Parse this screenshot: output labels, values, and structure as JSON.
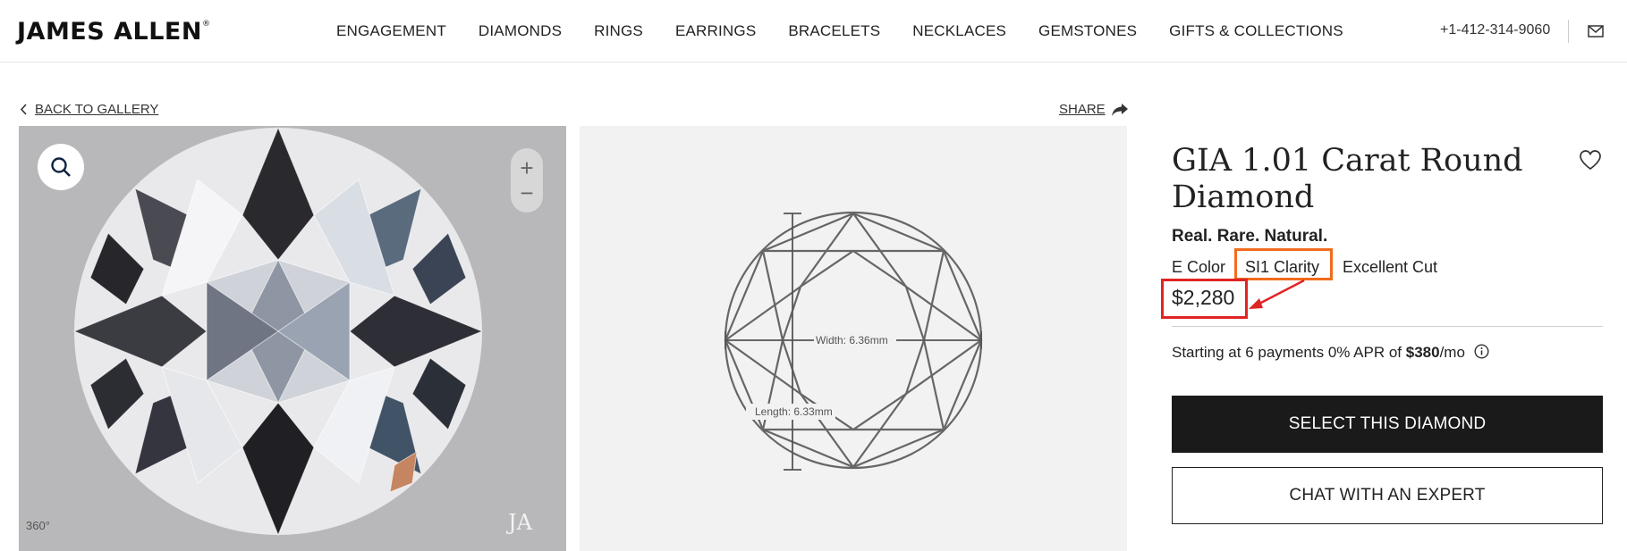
{
  "header": {
    "logo": "JAMES ALLEN",
    "logo_mark": "®",
    "nav": [
      "ENGAGEMENT",
      "DIAMONDS",
      "RINGS",
      "EARRINGS",
      "BRACELETS",
      "NECKLACES",
      "GEMSTONES",
      "GIFTS & COLLECTIONS"
    ],
    "phone": "+1-412-314-9060",
    "mail_icon": "envelope-icon"
  },
  "toolbar": {
    "back_label": "BACK TO GALLERY",
    "share_label": "SHARE"
  },
  "photo": {
    "zoom_in": "+",
    "zoom_out": "−",
    "rotate_label": "360°",
    "watermark": "JA"
  },
  "diagram": {
    "width_label": "Width: 6.36mm",
    "length_label": "Length: 6.33mm"
  },
  "product": {
    "title": "GIA 1.01 Carat Round Diamond",
    "tagline": "Real. Rare. Natural.",
    "color": "E Color",
    "clarity": "SI1 Clarity",
    "cut": "Excellent Cut",
    "price": "$2,280",
    "payments_prefix": "Starting at 6 payments 0% APR of ",
    "payments_amount": "$380",
    "payments_suffix": "/mo",
    "select_label": "SELECT THIS DIAMOND",
    "chat_label": "CHAT WITH AN EXPERT"
  },
  "colors": {
    "highlight_orange": "#f26b1d",
    "highlight_red": "#e02424",
    "button_dark": "#1a1a1a"
  }
}
